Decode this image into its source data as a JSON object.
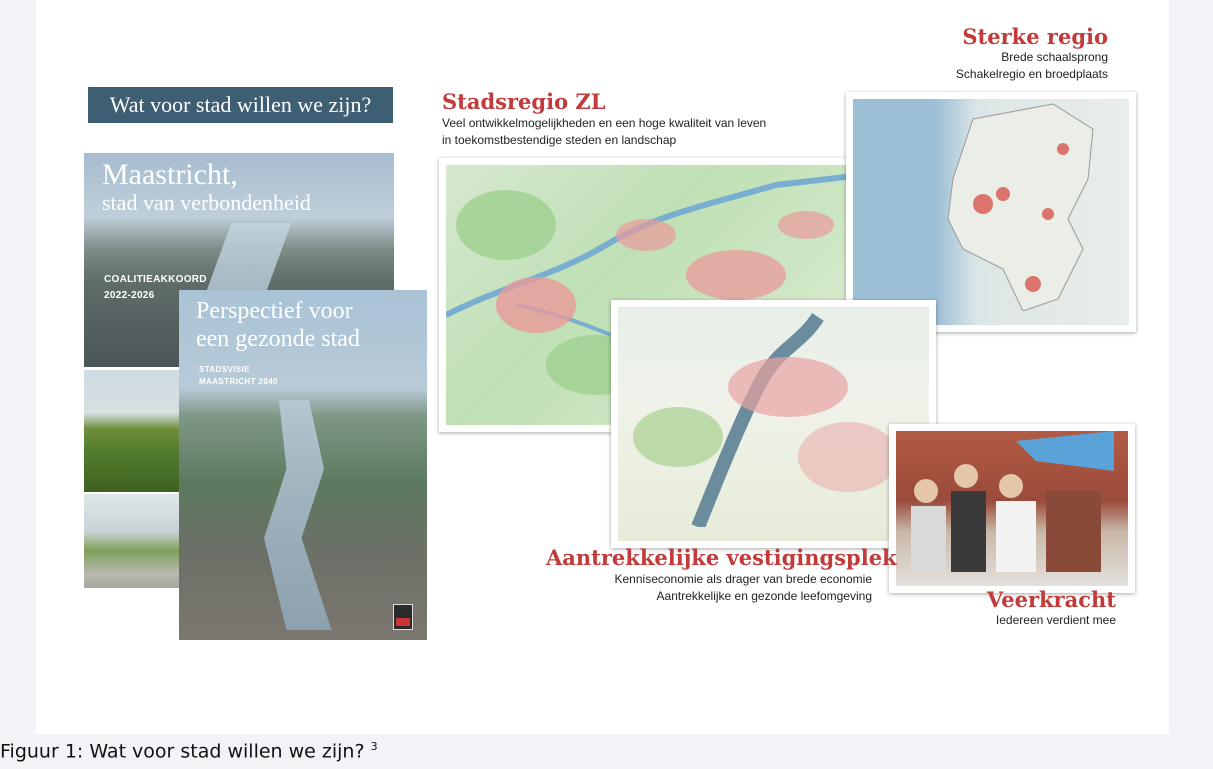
{
  "banner_title": "Wat voor stad willen we zijn?",
  "cover_maastricht": {
    "title": "Maastricht,",
    "subtitle": "stad van verbondenheid",
    "label": "COALITIEAKKOORD",
    "years": "2022-2026"
  },
  "cover_perspectief": {
    "title_line1": "Perspectief voor",
    "title_line2": "een gezonde stad",
    "label1": "STADSVISIE",
    "label2": "MAASTRICHT 2040"
  },
  "stadsregio": {
    "title": "Stadsregio ZL",
    "line1": "Veel ontwikkelmogelijkheden en een hoge kwaliteit van leven",
    "line2": "in toekomstbestendige steden en landschap"
  },
  "sterke_regio": {
    "title": "Sterke regio",
    "line1": "Brede schaalsprong",
    "line2": "Schakelregio en broedplaats"
  },
  "aantrekkelijke": {
    "title": "Aantrekkelijke vestigingsplek",
    "line1": "Kenniseconomie als drager van brede economie",
    "line2": "Aantrekkelijke en gezonde leefomgeving"
  },
  "veerkracht": {
    "title": "Veerkracht",
    "line1": "Iedereen verdient mee"
  },
  "caption": {
    "text": "Figuur 1: Wat voor stad willen we zijn?",
    "footnote": "3"
  },
  "colors": {
    "banner": "#3d5e73",
    "heading_red": "#c23a3a"
  }
}
